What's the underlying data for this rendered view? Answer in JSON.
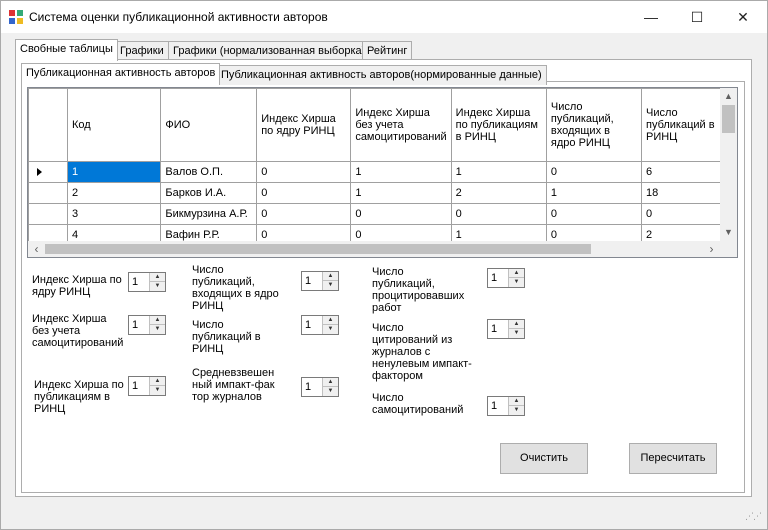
{
  "window": {
    "title": "Система оценки публикационной активности авторов",
    "icon": "app-grid-icon",
    "controls": {
      "minimize": "—",
      "maximize": "☐",
      "close": "✕"
    }
  },
  "tabs": [
    {
      "label": "Свобные таблицы",
      "active": true
    },
    {
      "label": "Графики",
      "active": false
    },
    {
      "label": "Графики (нормализованная выборка)",
      "active": false
    },
    {
      "label": "Рейтинг",
      "active": false
    }
  ],
  "subtabs": [
    {
      "label": "Публикационная активность авторов",
      "active": true
    },
    {
      "label": "Публикационная активность  авторов(нормированные данные)",
      "active": false
    }
  ],
  "grid": {
    "columns": [
      "Код",
      "ФИО",
      "Индекс Хирша по ядру РИНЦ",
      "Индекс Хирша без учета самоцитирований",
      "Индекс Хирша по публикациям в РИНЦ",
      "Число публикаций, входящих в ядро РИНЦ",
      "Число публикаций в РИНЦ"
    ],
    "rows": [
      [
        "1",
        "Валов О.П.",
        "0",
        "1",
        "1",
        "0",
        "6"
      ],
      [
        "2",
        "Барков И.А.",
        "0",
        "1",
        "2",
        "1",
        "18"
      ],
      [
        "3",
        "Бикмурзина А.Р.",
        "0",
        "0",
        "0",
        "0",
        "0"
      ],
      [
        "4",
        "Вафин Р.Р.",
        "0",
        "0",
        "1",
        "0",
        "2"
      ]
    ],
    "current_row_marker": "row-pointer-icon",
    "selected_row": 0
  },
  "fields": {
    "h_core": {
      "label": "Индекс Хирша по ядру РИНЦ",
      "value": "1"
    },
    "h_noself": {
      "label": "Индекс Хирша без учета самоцитирований",
      "value": "1"
    },
    "h_pub": {
      "label": "Индекс Хирша по публикациям в РИНЦ",
      "value": "1"
    },
    "pub_core": {
      "label": "Число публикаций, входящих в ядро РИНЦ",
      "value": "1"
    },
    "pub_rinc": {
      "label": "Число публикаций в РИНЦ",
      "value": "1"
    },
    "impact": {
      "label": "Средневзвешенный импакт-фактор журналов",
      "value": "1"
    },
    "cited_works": {
      "label": "Число публикаций, процитировавших работ",
      "value": "1"
    },
    "citations_nonzero": {
      "label": "Число цитирований из журналов с ненулевым импакт-фактором",
      "value": "1"
    },
    "self_citations": {
      "label": "Число самоцитирований",
      "value": "1"
    }
  },
  "buttons": {
    "clear": "Очистить",
    "recalc": "Пересчитать"
  }
}
